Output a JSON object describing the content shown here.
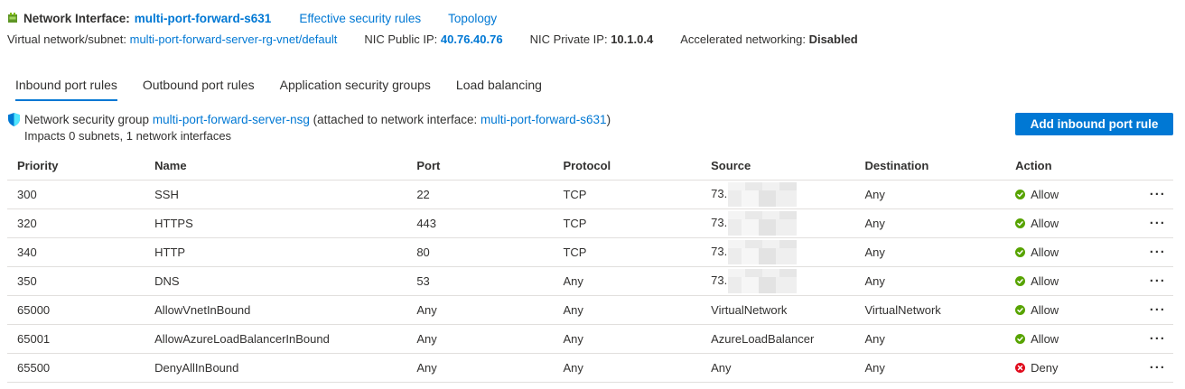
{
  "header": {
    "title": "Network Interface:",
    "nic_name": "multi-port-forward-s631",
    "links": [
      "Effective security rules",
      "Topology"
    ]
  },
  "details": {
    "vnet_label": "Virtual network/subnet:",
    "vnet_value": "multi-port-forward-server-rg-vnet/default",
    "public_ip_label": "NIC Public IP:",
    "public_ip_value": "40.76.40.76",
    "private_ip_label": "NIC Private IP:",
    "private_ip_value": "10.1.0.4",
    "accel_label": "Accelerated networking:",
    "accel_value": "Disabled"
  },
  "tabs": [
    {
      "label": "Inbound port rules",
      "active": true
    },
    {
      "label": "Outbound port rules",
      "active": false
    },
    {
      "label": "Application security groups",
      "active": false
    },
    {
      "label": "Load balancing",
      "active": false
    }
  ],
  "nsg": {
    "prefix": "Network security group",
    "name": "multi-port-forward-server-nsg",
    "middle": "(attached to network interface:",
    "nic": "multi-port-forward-s631",
    "suffix": ")",
    "impacts": "Impacts 0 subnets, 1 network interfaces"
  },
  "add_button_label": "Add inbound port rule",
  "table": {
    "columns": [
      "Priority",
      "Name",
      "Port",
      "Protocol",
      "Source",
      "Destination",
      "Action"
    ],
    "rows": [
      {
        "priority": "300",
        "name": "SSH",
        "port": "22",
        "protocol": "TCP",
        "source": "73.",
        "source_redacted": true,
        "destination": "Any",
        "action": "Allow"
      },
      {
        "priority": "320",
        "name": "HTTPS",
        "port": "443",
        "protocol": "TCP",
        "source": "73.",
        "source_redacted": true,
        "destination": "Any",
        "action": "Allow"
      },
      {
        "priority": "340",
        "name": "HTTP",
        "port": "80",
        "protocol": "TCP",
        "source": "73.",
        "source_redacted": true,
        "destination": "Any",
        "action": "Allow"
      },
      {
        "priority": "350",
        "name": "DNS",
        "port": "53",
        "protocol": "Any",
        "source": "73.",
        "source_redacted": true,
        "destination": "Any",
        "action": "Allow"
      },
      {
        "priority": "65000",
        "name": "AllowVnetInBound",
        "port": "Any",
        "protocol": "Any",
        "source": "VirtualNetwork",
        "source_redacted": false,
        "destination": "VirtualNetwork",
        "action": "Allow"
      },
      {
        "priority": "65001",
        "name": "AllowAzureLoadBalancerInBound",
        "port": "Any",
        "protocol": "Any",
        "source": "AzureLoadBalancer",
        "source_redacted": false,
        "destination": "Any",
        "action": "Allow"
      },
      {
        "priority": "65500",
        "name": "DenyAllInBound",
        "port": "Any",
        "protocol": "Any",
        "source": "Any",
        "source_redacted": false,
        "destination": "Any",
        "action": "Deny"
      }
    ],
    "more_label": "···"
  },
  "colors": {
    "accent": "#0078d4",
    "allow": "#57a300",
    "deny": "#e00b1c"
  },
  "icons": {
    "nic": "network-interface-icon",
    "nsg": "shield-icon",
    "allow": "check-circle-icon",
    "deny": "x-circle-icon",
    "more": "more-options-icon"
  }
}
